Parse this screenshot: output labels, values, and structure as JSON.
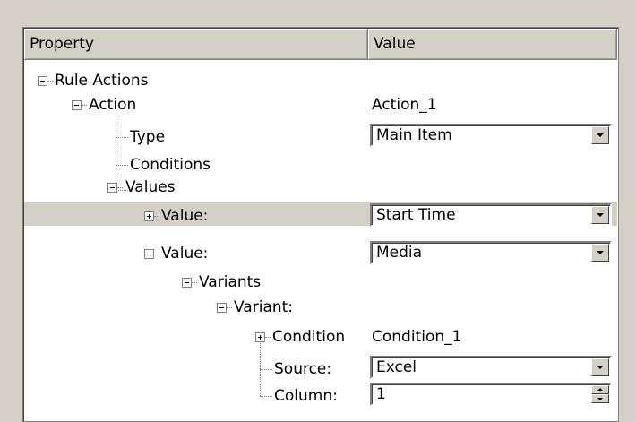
{
  "header": {
    "property": "Property",
    "value": "Value"
  },
  "tree": {
    "rule_actions": "Rule Actions",
    "action": {
      "label": "Action",
      "value": "Action_1"
    },
    "type": {
      "label": "Type",
      "value": "Main Item"
    },
    "conditions": {
      "label": "Conditions"
    },
    "values": {
      "label": "Values"
    },
    "value1": {
      "label": "Value:",
      "value": "Start Time"
    },
    "value2": {
      "label": "Value:",
      "value": "Media"
    },
    "variants": {
      "label": "Variants"
    },
    "variant": {
      "label": "Variant:"
    },
    "condition": {
      "label": "Condition",
      "value": "Condition_1"
    },
    "source": {
      "label": "Source:",
      "value": "Excel"
    },
    "column": {
      "label": "Column:",
      "value": "1"
    }
  },
  "colors": {
    "background": "#d4d0c8",
    "selected_row": "#d4d0c8",
    "grid": "#ffffff"
  },
  "icons": [
    "collapse-icon",
    "expand-icon",
    "dropdown-arrow-icon",
    "spin-up-icon",
    "spin-down-icon"
  ]
}
